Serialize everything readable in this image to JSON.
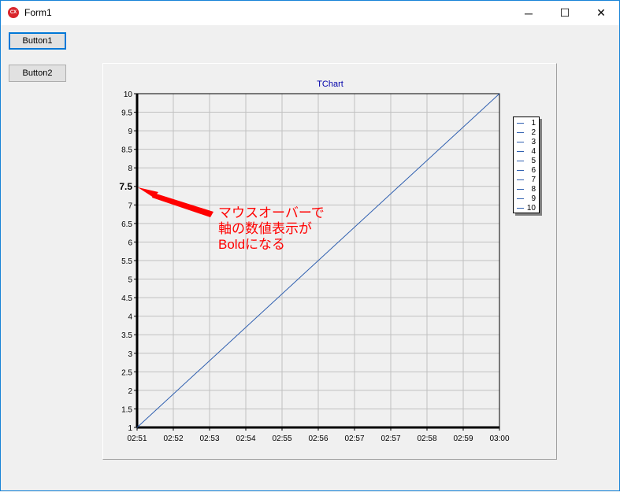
{
  "window": {
    "title": "Form1",
    "icon": "cx-app-icon",
    "minimize": "─",
    "maximize": "☐",
    "close": "✕"
  },
  "buttons": {
    "button1": "Button1",
    "button2": "Button2"
  },
  "annotation": {
    "lines": [
      "マウスオーバーで",
      "軸の数値表示が",
      "Boldになる"
    ]
  },
  "colors": {
    "series": "#3060b0",
    "annotation": "#ff0000",
    "title": "#0000aa"
  },
  "chart_data": {
    "type": "line",
    "title": "TChart",
    "xlabel": "",
    "ylabel": "",
    "x_tick_labels": [
      "02:51",
      "02:52",
      "02:53",
      "02:54",
      "02:55",
      "02:56",
      "02:57",
      "02:57",
      "02:58",
      "02:59",
      "03:00"
    ],
    "y_tick_labels": [
      "1",
      "1.5",
      "2",
      "2.5",
      "3",
      "3.5",
      "4",
      "4.5",
      "5",
      "5.5",
      "6",
      "6.5",
      "7",
      "7.5",
      "8",
      "8.5",
      "9",
      "9.5",
      "10"
    ],
    "ylim": [
      1,
      10
    ],
    "bold_tick": "7.5",
    "grid": true,
    "legend": {
      "placement": "right",
      "entries": [
        "1",
        "2",
        "3",
        "4",
        "5",
        "6",
        "7",
        "8",
        "9",
        "10"
      ]
    },
    "series": [
      {
        "name": "1",
        "x": [
          0,
          1
        ],
        "values": [
          1,
          10
        ]
      }
    ]
  }
}
